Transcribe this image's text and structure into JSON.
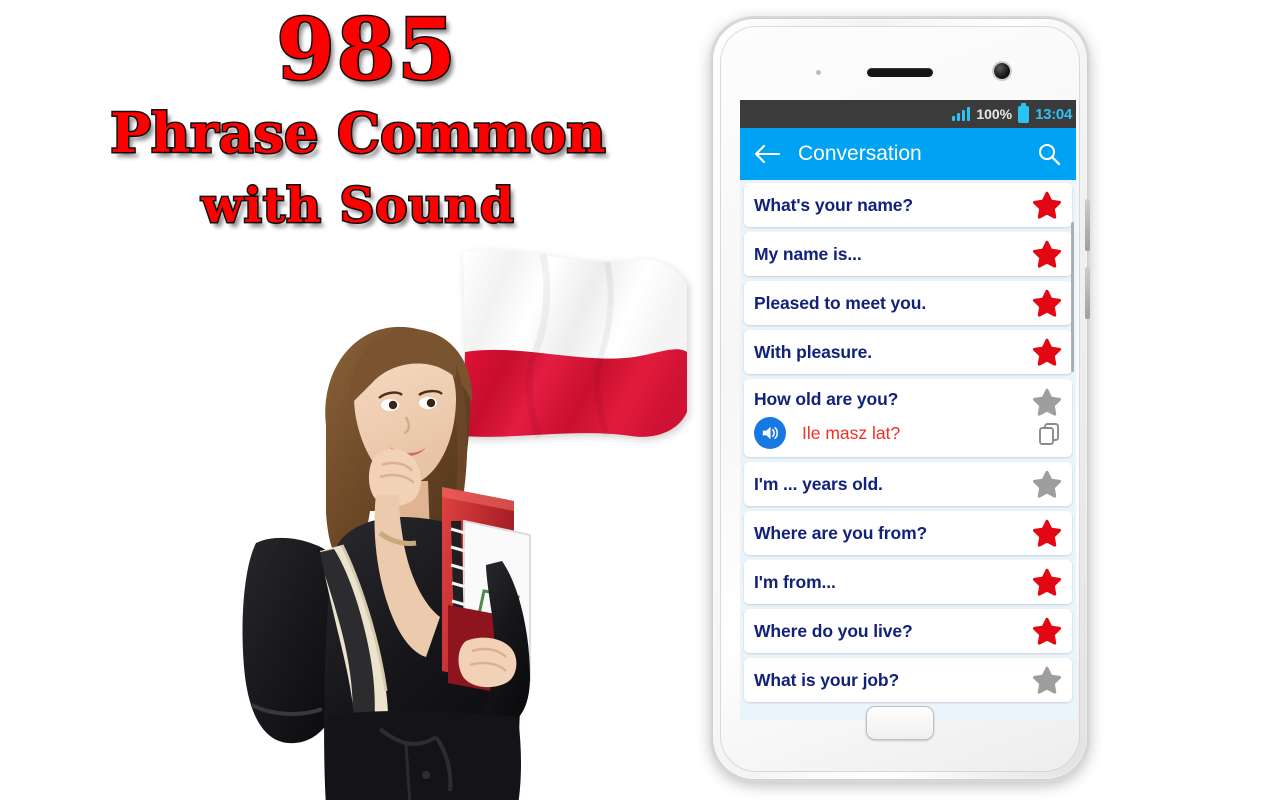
{
  "promo": {
    "count": "985",
    "line2": "Phrase Common",
    "line3": "with Sound",
    "title_color": "#FF0000",
    "outline_color": "#111111"
  },
  "flag": {
    "name": "poland-flag",
    "top_color": "#FFFFFF",
    "bottom_color": "#DC143C"
  },
  "phone": {
    "status_bar": {
      "signal": "signal-bars-icon",
      "battery_percent": "100%",
      "battery_icon": "battery-full-icon",
      "time": "13:04",
      "background": "#3B3B3B",
      "accent": "#2BC3F5"
    },
    "app_bar": {
      "back_icon": "back-arrow-icon",
      "title": "Conversation",
      "search_icon": "search-icon",
      "background": "#00A2F3"
    },
    "list": {
      "background": "#EAF4FB",
      "phrase_color": "#12217A",
      "translation_color": "#F03024",
      "star_favorite_color": "#E30613",
      "star_inactive_color": "#9E9E9E",
      "items": [
        {
          "phrase": "What's your name?",
          "favorite": true,
          "expanded": false,
          "translation": ""
        },
        {
          "phrase": "My name is...",
          "favorite": true,
          "expanded": false,
          "translation": ""
        },
        {
          "phrase": "Pleased to meet you.",
          "favorite": true,
          "expanded": false,
          "translation": ""
        },
        {
          "phrase": "With pleasure.",
          "favorite": true,
          "expanded": false,
          "translation": ""
        },
        {
          "phrase": "How old are you?",
          "favorite": false,
          "expanded": true,
          "translation": "Ile masz lat?",
          "speaker_icon": "speaker-icon",
          "copy_icon": "copy-icon"
        },
        {
          "phrase": "I'm ... years old.",
          "favorite": false,
          "expanded": false,
          "translation": ""
        },
        {
          "phrase": "Where are you from?",
          "favorite": true,
          "expanded": false,
          "translation": ""
        },
        {
          "phrase": "I'm from...",
          "favorite": true,
          "expanded": false,
          "translation": ""
        },
        {
          "phrase": "Where do you live?",
          "favorite": true,
          "expanded": false,
          "translation": ""
        },
        {
          "phrase": "What is your job?",
          "favorite": false,
          "expanded": false,
          "translation": ""
        }
      ]
    },
    "hardware": {
      "earpiece": "earpiece-speaker",
      "front_camera": "front-camera",
      "home_button": "home-button",
      "volume_up": "volume-up-button",
      "volume_down": "volume-down-button"
    }
  },
  "student": {
    "name": "student-photo",
    "description": "young female student with backpack holding books"
  }
}
